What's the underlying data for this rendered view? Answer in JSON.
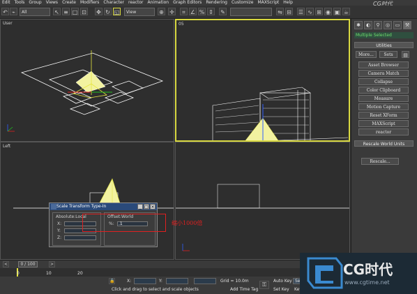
{
  "menu": [
    "Edit",
    "Tools",
    "Group",
    "Views",
    "Create",
    "Modifiers",
    "Character",
    "reactor",
    "Animation",
    "Graph Editors",
    "Rendering",
    "Customize",
    "MAXScript",
    "Help"
  ],
  "toolbar": {
    "selection_filter": "All",
    "ref_coord": "View"
  },
  "watermark": {
    "logo_top": "CG时代"
  },
  "viewports": {
    "top_left": "User",
    "top_right": "05",
    "bottom_left": "Left"
  },
  "command_panel": {
    "selection": "Multiple Selected",
    "rollout_utilities": "Utilities",
    "more_label": "More...",
    "sets_label": "Sets",
    "utilities": [
      "Asset Browser",
      "Camera Match",
      "Collapse",
      "Color Clipboard",
      "Measure",
      "Motion Capture",
      "Reset XForm",
      "MAXScript",
      "reactor"
    ],
    "rollout_rescale": "Rescale World Units",
    "rescale_button": "Rescale..."
  },
  "dialog": {
    "title": "Scale Transform Type-In",
    "absolute_label": "Absolute:Local",
    "offset_label": "Offset:World",
    "axis_x": "X:",
    "axis_y": "Y:",
    "axis_z": "Z:",
    "percent_label": "%:",
    "offset_value": ".1"
  },
  "annotation": {
    "text": "缩小1000倍",
    "color": "#e02020"
  },
  "timeline": {
    "frame_display": "0 / 100",
    "tick_labels": [
      "0",
      "10",
      "20"
    ]
  },
  "status": {
    "x_label": "X:",
    "y_label": "Y:",
    "grid": "Grid = 10.0m",
    "autokey": "Auto Key",
    "selected": "Selected",
    "setkey": "Set Key",
    "key_filters": "Key Filters...",
    "prompt": "Click and drag to select and scale objects",
    "add_time_tag": "Add Time Tag"
  },
  "logo": {
    "brand": "CG时代",
    "url": "www.cgtime.net"
  },
  "colors": {
    "accent_yellow": "#e6e640",
    "selection_green": "#6ee06e",
    "annotation_red": "#e02020"
  }
}
